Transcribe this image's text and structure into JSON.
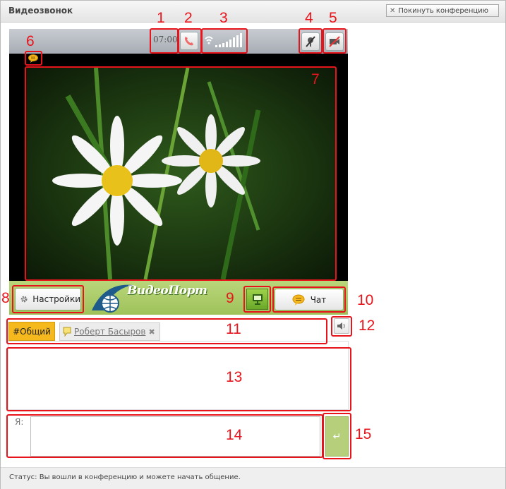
{
  "window": {
    "title": "Видеозвонок",
    "leave_button": "Покинуть конференцию"
  },
  "toolbar": {
    "timer": "07:00",
    "hangup_icon": "phone-hangup-icon",
    "signal_icon": "signal-strength-icon",
    "mic_icon": "mic-muted-icon",
    "camera_icon": "camera-off-icon"
  },
  "video": {
    "chat_notice_icon": "chat-bubble-icon",
    "image": "daisies photo"
  },
  "controls": {
    "settings_label": "Настройки",
    "logo_text": "ВидеоПорт",
    "share_icon": "screen-share-icon",
    "chat_label": "Чат"
  },
  "chat": {
    "tabs": [
      {
        "label": "#Общий"
      },
      {
        "label": "Роберт Басыров"
      }
    ],
    "sound_icon": "speaker-icon",
    "me_label": "Я:",
    "input_value": "",
    "send_icon": "enter-icon"
  },
  "status": {
    "text": "Статус: Вы вошли в конференцию и можете начать общение."
  },
  "annotations": [
    "1",
    "2",
    "3",
    "4",
    "5",
    "6",
    "7",
    "8",
    "9",
    "10",
    "11",
    "12",
    "13",
    "14",
    "15"
  ],
  "colors": {
    "accent_green": "#9fc25a",
    "tab_orange": "#f6b91d",
    "annotation_red": "#e8141c"
  }
}
